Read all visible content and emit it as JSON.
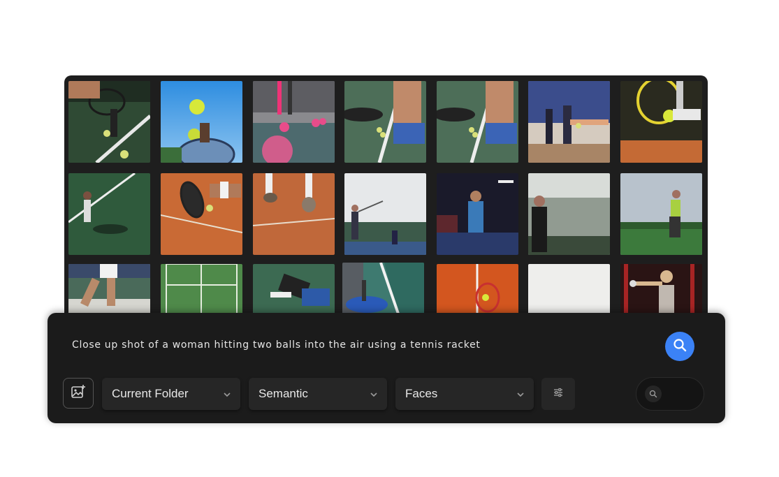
{
  "search": {
    "query": "Close up shot of a woman hitting two balls into the air using a tennis racket"
  },
  "filters": {
    "scope": "Current Folder",
    "mode": "Semantic",
    "faces": "Faces"
  },
  "icons": {
    "image_add": "image-add-icon",
    "search": "search-icon",
    "filter": "sliders-icon",
    "chevron": "chevron-down-icon"
  },
  "colors": {
    "accent": "#3b82f6",
    "panel": "#1b1b1b",
    "gallery": "#1e1e1e"
  },
  "gallery": {
    "photos": [
      "tennis-player-legs-balls",
      "tennis-balls-sky-racket",
      "pink-balls-indoor-court",
      "player-feet-balls-court",
      "player-feet-balls-court-copy",
      "players-indoor-court-hall",
      "racket-ball-feet-clay",
      "player-shadow-green-court",
      "racket-hitting-ball-clay",
      "feet-on-clay-court",
      "player-serve-outdoor",
      "player-indoor-blue-court",
      "player-standing-fence",
      "golfer-swing-field",
      "player-legs-white-court",
      "green-court-net-aerial",
      "player-lying-court",
      "racket-on-court",
      "racket-on-clay-aerial",
      "blank-white-photo",
      "woman-training-gym"
    ]
  }
}
